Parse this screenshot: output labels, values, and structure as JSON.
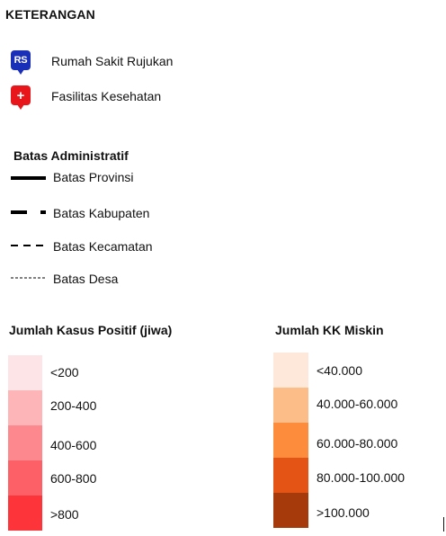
{
  "legend": {
    "title": "KETERANGAN",
    "points": [
      {
        "icon": "rumah-sakit-marker-icon",
        "badge": "RS",
        "label": "Rumah Sakit Rujukan",
        "color": "#1a2fb8"
      },
      {
        "icon": "health-facility-marker-icon",
        "badge": "+",
        "label": "Fasilitas Kesehatan",
        "color": "#e8151b"
      }
    ],
    "boundaries": {
      "title": "Batas Administratif",
      "items": [
        {
          "label": "Batas Provinsi",
          "style": "thick-solid"
        },
        {
          "label": "Batas Kabupaten",
          "style": "thick-long-dash"
        },
        {
          "label": "Batas Kecamatan",
          "style": "medium-dash"
        },
        {
          "label": "Batas Desa",
          "style": "fine-dash"
        }
      ]
    },
    "cases": {
      "title": "Jumlah Kasus Positif (jiwa)",
      "classes": [
        {
          "label": "<200",
          "color": "#fde4e6"
        },
        {
          "label": "200-400",
          "color": "#fdb5b8"
        },
        {
          "label": "400-600",
          "color": "#fd888d"
        },
        {
          "label": "600-800",
          "color": "#fd6167"
        },
        {
          "label": ">800",
          "color": "#fd353b"
        }
      ]
    },
    "poverty": {
      "title": "Jumlah KK Miskin",
      "classes": [
        {
          "label": "<40.000",
          "color": "#fde8d9"
        },
        {
          "label": "40.000-60.000",
          "color": "#fdbd88"
        },
        {
          "label": "60.000-80.000",
          "color": "#fd8c3d"
        },
        {
          "label": "80.000-100.000",
          "color": "#e45414"
        },
        {
          "label": ">100.000",
          "color": "#a63a0b"
        }
      ]
    }
  }
}
